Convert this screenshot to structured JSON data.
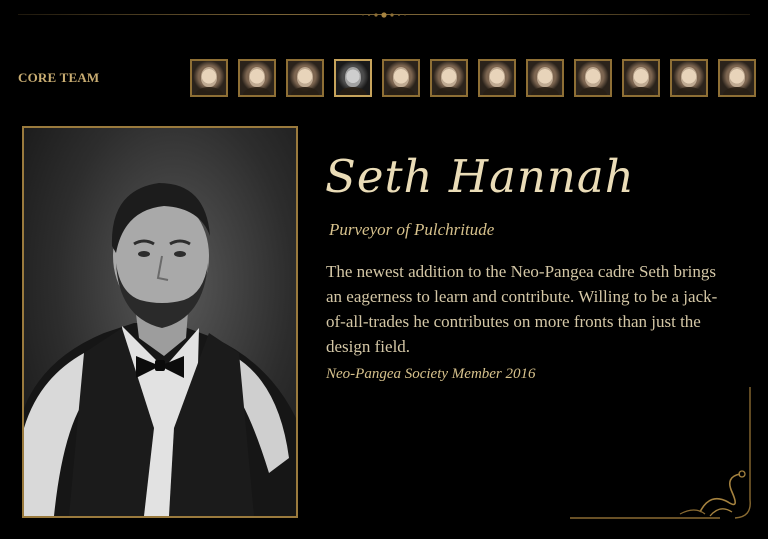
{
  "section": {
    "label": "CORE TEAM"
  },
  "team_thumbnails": [
    {
      "state": "inactive"
    },
    {
      "state": "inactive"
    },
    {
      "state": "inactive"
    },
    {
      "state": "active"
    },
    {
      "state": "inactive"
    },
    {
      "state": "inactive"
    },
    {
      "state": "inactive"
    },
    {
      "state": "inactive"
    },
    {
      "state": "inactive"
    },
    {
      "state": "inactive"
    },
    {
      "state": "inactive"
    },
    {
      "state": "inactive"
    }
  ],
  "profile": {
    "name": "Seth Hannah",
    "title": "Purveyor of Pulchritude",
    "bio": "The newest addition to the Neo-Pangea cadre Seth brings an eagerness to learn and contribute. Willing to be a jack-of-all-trades he contributes on more fronts than just the design field.",
    "membership": "Neo-Pangea Society Member 2016"
  },
  "colors": {
    "background": "#000000",
    "gold": "#9a7a3d",
    "text": "#d4c7a6"
  }
}
